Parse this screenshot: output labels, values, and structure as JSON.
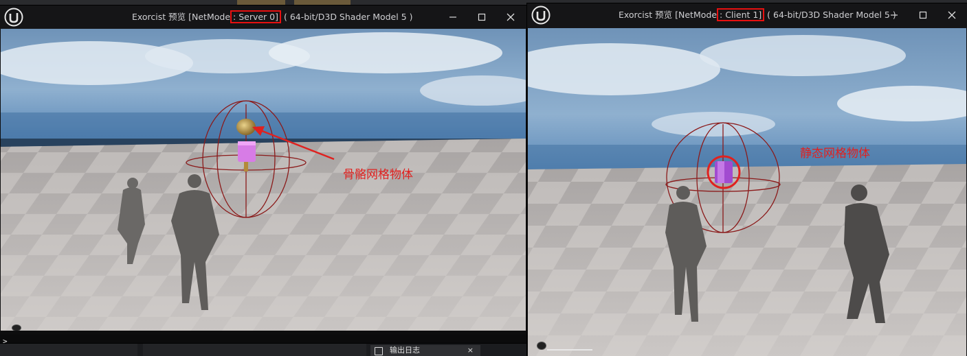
{
  "server_window": {
    "title_prefix": "Exorcist 预览 [NetMode",
    "title_highlight": ": Server 0]",
    "title_suffix": " ( 64-bit/D3D Shader Model 5 )",
    "annotation": "骨骼网格物体",
    "console_prompt": ">_",
    "controls": [
      "minimize",
      "maximize",
      "close"
    ]
  },
  "client_window": {
    "title_prefix": "Exorcist 预览 [NetMode",
    "title_highlight": ": Client 1]",
    "title_suffix": " ( 64-bit/D3D Shader Model 5 )",
    "annotation": "静态网格物体",
    "controls": [
      "minimize",
      "maximize",
      "close"
    ]
  },
  "output_log_tab": {
    "label": "输出日志",
    "close": "×"
  },
  "colors": {
    "annotation_red": "#e0211f",
    "debug_sphere": "#8b1a1a",
    "title_bar": "#151517"
  }
}
